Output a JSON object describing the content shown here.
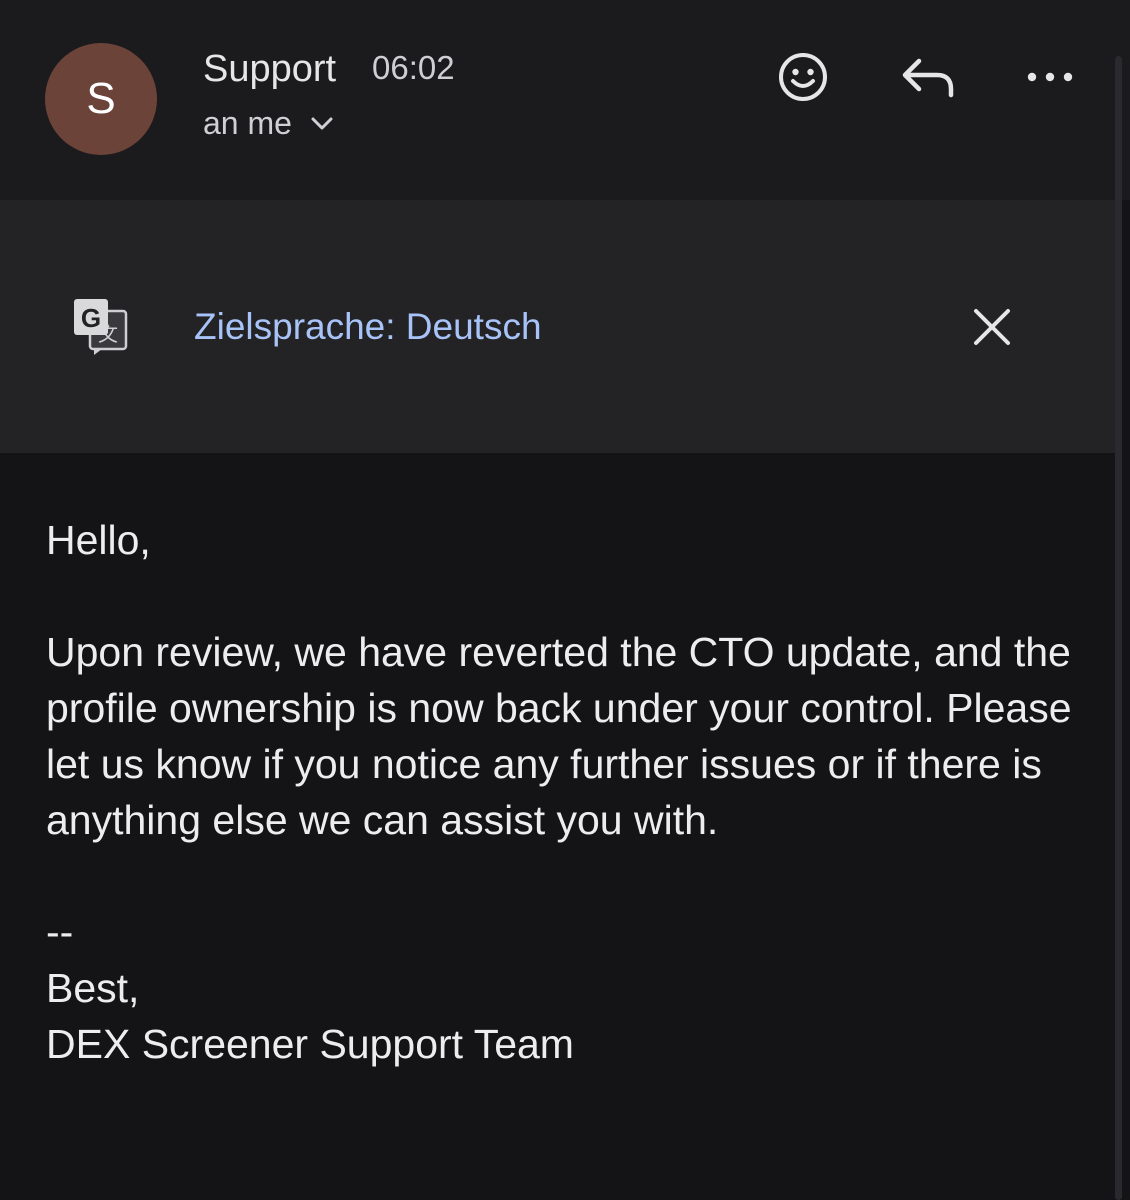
{
  "header": {
    "avatar_letter": "S",
    "sender": "Support",
    "time": "06:02",
    "recipient": "an me",
    "icons": {
      "recipient_toggle": "chevron-down-icon",
      "emoji": "emoji-icon",
      "reply": "reply-icon",
      "more": "more-icon"
    }
  },
  "translate": {
    "icon": "google-translate-icon",
    "label": "Zielsprache: Deutsch",
    "close_icon": "close-icon"
  },
  "email": {
    "greeting": "Hello,",
    "paragraph": "Upon review, we have reverted the CTO update, and the profile ownership is now back under your control. Please let us know if you notice any further issues or if there is anything else we can assist you with.",
    "separator": "--",
    "closing": "Best,",
    "signature": "DEX Screener Support Team"
  },
  "colors": {
    "background": "#141416",
    "header_bg": "#1b1b1d",
    "translate_bg": "#232325",
    "avatar_bg": "#6b4339",
    "link": "#a8c3f7"
  }
}
